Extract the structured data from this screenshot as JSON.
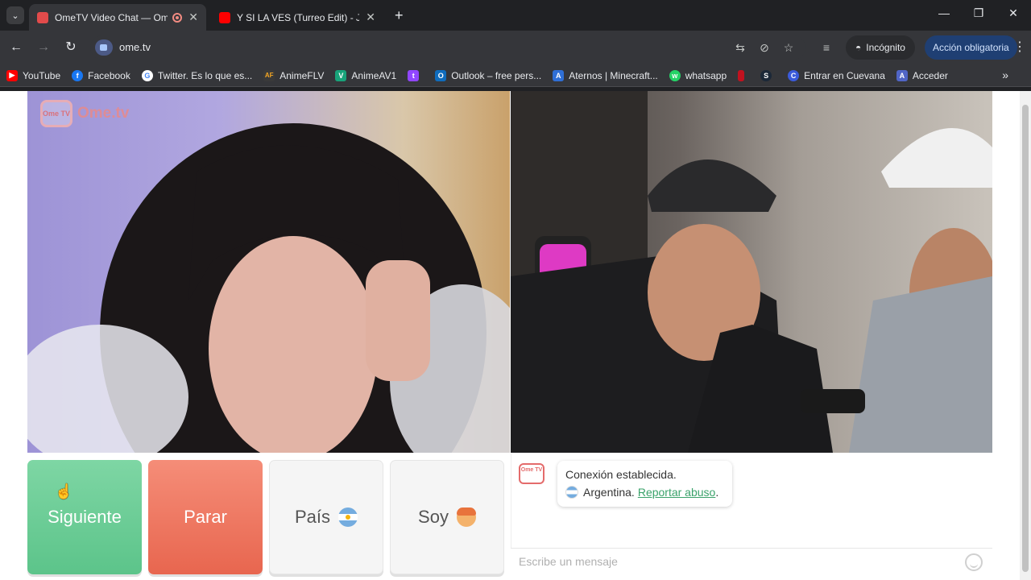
{
  "browser": {
    "tabs": [
      {
        "title": "OmeTV Video Chat — Ome",
        "active": true,
        "favicon_color": "#e24b4b"
      },
      {
        "title": "Y SI LA VES (Turreo Edit) - Jona",
        "active": false,
        "favicon_color": "#ff0000"
      }
    ],
    "new_tab": "+",
    "window_controls": {
      "minimize": "—",
      "restore": "❐",
      "close": "✕"
    },
    "url": "ome.tv",
    "incognito_label": "Incógnito",
    "action_label": "Acción obligatoria",
    "bookmarks": [
      {
        "label": "YouTube",
        "icon": "youtube-icon",
        "color": "#ff0000",
        "glyph": "▶"
      },
      {
        "label": "Facebook",
        "icon": "facebook-icon",
        "color": "#1877f2",
        "glyph": "f"
      },
      {
        "label": "Twitter. Es lo que es...",
        "icon": "google-icon",
        "color": "#4285f4",
        "glyph": "G"
      },
      {
        "label": "AnimeFLV",
        "icon": "animeflv-icon",
        "color": "#3a3a3a",
        "glyph": "AF"
      },
      {
        "label": "AnimeAV1",
        "icon": "animeav1-icon",
        "color": "#18a37a",
        "glyph": "V"
      },
      {
        "label": "",
        "icon": "twitch-icon",
        "color": "#9146ff",
        "glyph": "t"
      },
      {
        "label": "Outlook – free pers...",
        "icon": "outlook-icon",
        "color": "#0f6cbd",
        "glyph": "O"
      },
      {
        "label": "Aternos | Minecraft...",
        "icon": "aternos-icon",
        "color": "#2f6fd6",
        "glyph": "A"
      },
      {
        "label": "whatsapp",
        "icon": "whatsapp-icon",
        "color": "#25d366",
        "glyph": "w"
      },
      {
        "label": "",
        "icon": "red-bookmark-icon",
        "color": "#c1121f",
        "glyph": ""
      },
      {
        "label": "",
        "icon": "steam-icon",
        "color": "#1b2838",
        "glyph": "S"
      },
      {
        "label": "Entrar en Cuevana",
        "icon": "cuevana-icon",
        "color": "#3b5bdb",
        "glyph": "C"
      },
      {
        "label": "Acceder",
        "icon": "acceder-icon",
        "color": "#5065c6",
        "glyph": "A"
      }
    ]
  },
  "ome": {
    "logo_tv": "Ome TV",
    "logo_text": "Ome.tv",
    "buttons": {
      "next": "Siguiente",
      "stop": "Parar",
      "country": "País",
      "me": "Soy"
    },
    "chat": {
      "logo": "Ome TV",
      "status": "Conexión establecida.",
      "country": "Argentina.",
      "report": "Reportar abuso",
      "report_suffix": ".",
      "placeholder": "Escribe un mensaje"
    }
  }
}
